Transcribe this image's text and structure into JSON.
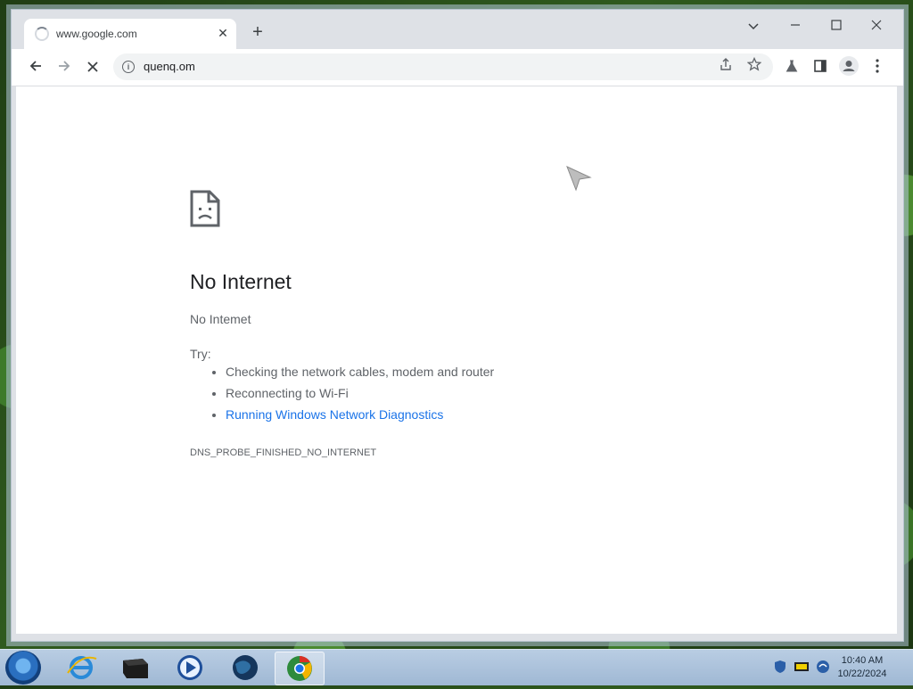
{
  "browser": {
    "tab": {
      "title": "www.google.com"
    },
    "window_controls": {
      "dropdown": "⌄",
      "minimize": "—",
      "maximize": "☐",
      "close": "✕"
    },
    "toolbar": {
      "url": "quenq.om"
    }
  },
  "error_page": {
    "title": "No Internet",
    "subtitle": "No Intemet",
    "try_label": "Try:",
    "suggestions": [
      "Checking the network cables, modem and router",
      "Reconnecting to Wi-Fi",
      "Running Windows Network Diagnostics"
    ],
    "error_code": "DNS_PROBE_FINISHED_NO_INTERNET"
  },
  "taskbar": {
    "clock": {
      "time": "10:40 AM",
      "date": "10/22/2024"
    },
    "apps": [
      "internet-explorer-icon",
      "app-box-icon",
      "media-player-icon",
      "globe-icon",
      "chrome-icon"
    ]
  },
  "colors": {
    "link": "#1a73e8",
    "title_text": "#202124",
    "secondary_text": "#5f6368"
  }
}
